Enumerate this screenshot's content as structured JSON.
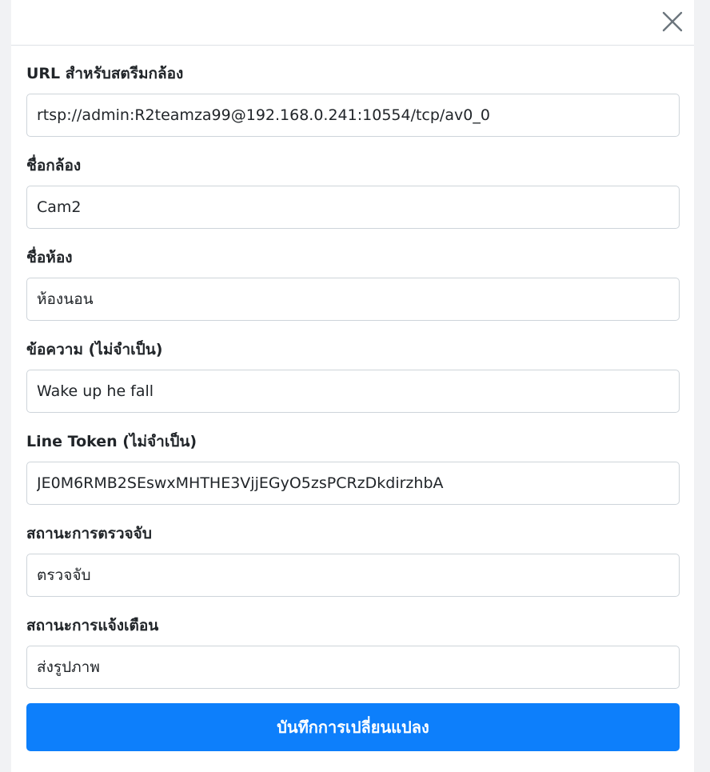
{
  "dialog": {
    "close_icon": "close-icon"
  },
  "fields": {
    "stream_url": {
      "label": "URL สำหรับสตรีมกล้อง",
      "value": "rtsp://admin:R2teamza99@192.168.0.241:10554/tcp/av0_0"
    },
    "camera_name": {
      "label": "ชื่อกล้อง",
      "value": "Cam2"
    },
    "room_name": {
      "label": "ชื่อห้อง",
      "value": "ห้องนอน"
    },
    "message": {
      "label": "ข้อความ (ไม่จำเป็น)",
      "value": "Wake up he fall"
    },
    "line_token": {
      "label": "Line Token (ไม่จำเป็น)",
      "value": "JE0M6RMB2SEswxMHTHE3VjjEGyO5zsPCRzDkdirzhbA"
    },
    "detection_status": {
      "label": "สถานะการตรวจจับ",
      "value": "ตรวจจับ"
    },
    "alert_status": {
      "label": "สถานะการแจ้งเตือน",
      "value": "ส่งรูปภาพ"
    }
  },
  "actions": {
    "save_label": "บันทึกการเปลี่ยนแปลง"
  },
  "colors": {
    "primary": "#0d7ffb",
    "border": "#ced4da",
    "text": "#212529"
  }
}
